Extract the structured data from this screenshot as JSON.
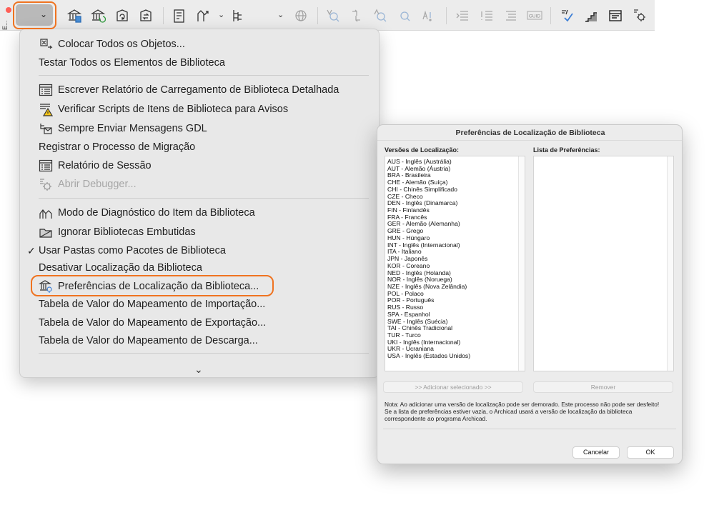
{
  "window": {
    "label": "E..."
  },
  "toolbar": {
    "dropdown_chevron": "⌄",
    "icons": [
      "library-manager-icon",
      "library-report-icon",
      "reload-libraries-icon",
      "migrate-libraries-icon",
      "library-part-icon",
      "library-part-arrow-icon",
      "hierarchy-icon",
      "globe-icon",
      "find-icon",
      "replace-icon",
      "search-text-icon",
      "search-zoom-icon",
      "find-replace-icon",
      "indent-icon",
      "warning-list-icon",
      "list-icon",
      "guid-icon",
      "script-check-icon",
      "stairs-icon",
      "window-icon",
      "debug-icon"
    ]
  },
  "menu": {
    "items": [
      {
        "label": "Colocar Todos os Objetos...",
        "icon": "place-objects-icon"
      },
      {
        "label": "Testar Todos os Elementos de Biblioteca"
      },
      {
        "label": "Escrever Relatório de Carregamento de Biblioteca Detalhada",
        "icon": "report-icon"
      },
      {
        "label": "Verificar Scripts de Itens de Biblioteca para Avisos",
        "icon": "warning-scripts-icon"
      },
      {
        "label": "Sempre Enviar Mensagens GDL",
        "icon": "gdl-messages-icon"
      },
      {
        "label": "Registrar o Processo de Migração"
      },
      {
        "label": "Relatório de Sessão",
        "icon": "session-report-icon"
      },
      {
        "label": "Abrir Debugger...",
        "icon": "debugger-icon"
      },
      {
        "label": "Modo de Diagnóstico do Item da Biblioteca",
        "icon": "diagnostic-icon"
      },
      {
        "label": "Ignorar Bibliotecas Embutidas",
        "icon": "ignore-embedded-icon"
      },
      {
        "label": "Usar Pastas como Pacotes de Biblioteca",
        "check": "✓"
      },
      {
        "label": "Desativar Localização da Biblioteca"
      },
      {
        "label": "Preferências de Localização da Biblioteca...",
        "icon": "localization-prefs-icon"
      },
      {
        "label": "Tabela de Valor do Mapeamento de Importação..."
      },
      {
        "label": "Tabela de Valor do Mapeamento de Exportação..."
      },
      {
        "label": "Tabela de Valor do Mapeamento de Descarga..."
      }
    ],
    "more_indicator": "⌄"
  },
  "dialog": {
    "title": "Preferências de Localização de Biblioteca",
    "versions_label": "Versões de Localização:",
    "preferences_label": "Lista de Preferências:",
    "versions": [
      "AUS - Inglês (Austrália)",
      "AUT - Alemão (Áustria)",
      "BRA - Brasileira",
      "CHE - Alemão (Suíça)",
      "CHI - Chinês Simplificado",
      "CZE - Checo",
      "DEN - Inglês (Dinamarca)",
      "FIN - Finlandês",
      "FRA - Francês",
      "GER - Alemão (Alemanha)",
      "GRE - Grego",
      "HUN - Húngaro",
      "INT - Inglês (Internacional)",
      "ITA - Italiano",
      "JPN - Japonês",
      "KOR - Coreano",
      "NED - Inglês (Holanda)",
      "NOR - Inglês (Noruega)",
      "NZE - Inglês (Nova Zelândia)",
      "POL - Polaco",
      "POR - Português",
      "RUS - Russo",
      "SPA - Espanhol",
      "SWE - Inglês (Suécia)",
      "TAI - Chinês Tradicional",
      "TUR - Turco",
      "UKI - Inglês (Internacional)",
      "UKR - Ucraniana",
      "USA - Inglês (Estados Unidos)"
    ],
    "add_button": ">> Adicionar selecionado >>",
    "remove_button": "Remover",
    "note_line1": "Nota: Ao adicionar uma versão de localização pode ser demorado. Este processo não pode ser desfeito!",
    "note_line2": "Se a lista de preferências estiver vazia, o Archicad usará a versão de localização da biblioteca correspondente ao programa Archicad.",
    "cancel_button": "Cancelar",
    "ok_button": "OK"
  },
  "colors": {
    "highlight": "#ef7320",
    "menu_bg": "#e8e8e8",
    "dialog_bg": "#ececec",
    "disabled_text": "#a6a6a6"
  }
}
